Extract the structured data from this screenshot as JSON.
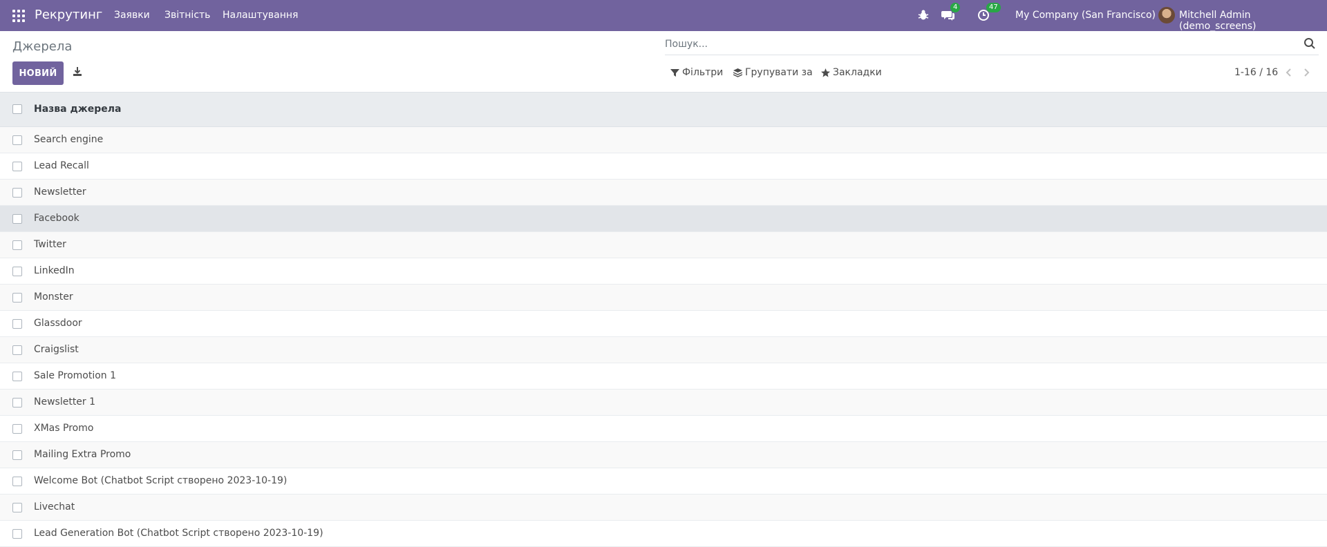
{
  "navbar": {
    "brand": "Рекрутинг",
    "menu": [
      "Заявки",
      "Звітність",
      "Налаштування"
    ],
    "messages_count": "4",
    "activities_count": "47",
    "company": "My Company (San Francisco)",
    "user": "Mitchell Admin (demo_screens)"
  },
  "control_panel": {
    "title": "Джерела",
    "new_button": "НОВИЙ",
    "search_placeholder": "Пошук...",
    "filters": "Фільтри",
    "group_by": "Групувати за",
    "favorites": "Закладки",
    "pager": "1-16 / 16"
  },
  "table": {
    "header": "Назва джерела",
    "rows": [
      "Search engine",
      "Lead Recall",
      "Newsletter",
      "Facebook",
      "Twitter",
      "LinkedIn",
      "Monster",
      "Glassdoor",
      "Craigslist",
      "Sale Promotion 1",
      "Newsletter 1",
      "XMas Promo",
      "Mailing Extra Promo",
      "Welcome Bot (Chatbot Script створено 2023-10-19)",
      "Livechat",
      "Lead Generation Bot (Chatbot Script створено 2023-10-19)"
    ]
  },
  "colors": {
    "brand": "#71639e",
    "badge": "#28a745"
  }
}
